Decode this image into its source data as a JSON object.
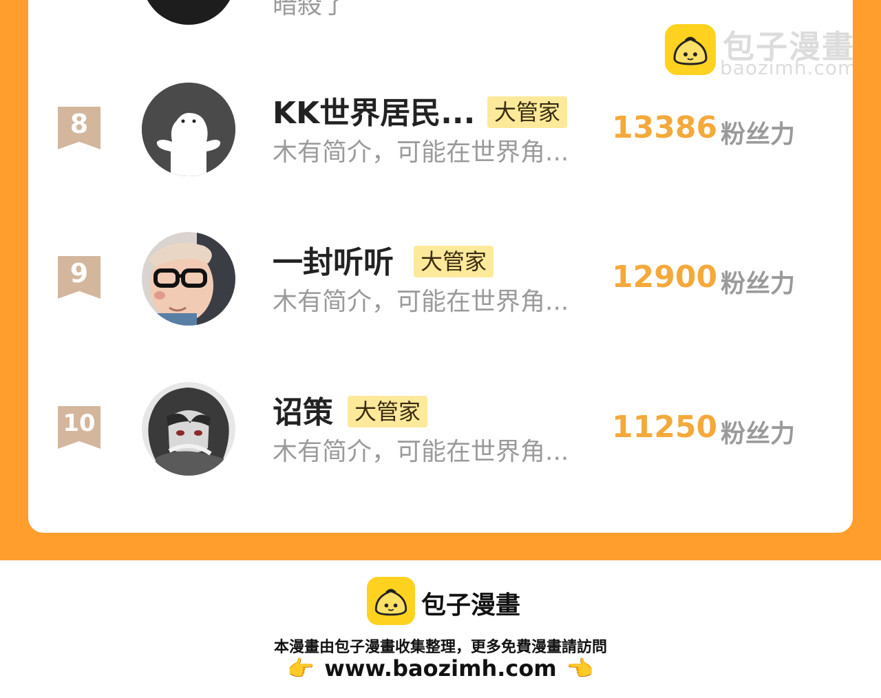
{
  "watermark": {
    "title": "包子漫畫",
    "subtitle": "baozimh.com"
  },
  "partial_row": {
    "text": "暗殺了"
  },
  "rows": [
    {
      "rank": "8",
      "name": "KK世界居民...",
      "badge": "大管家",
      "desc": "木有简介，可能在世界角...",
      "score": "13386",
      "unit": "粉丝力",
      "avatar": "default-ghost-avatar"
    },
    {
      "rank": "9",
      "name": "一封听听",
      "badge": "大管家",
      "desc": "木有简介，可能在世界角...",
      "score": "12900",
      "unit": "粉丝力",
      "avatar": "child-with-glasses-avatar"
    },
    {
      "rank": "10",
      "name": "诏策",
      "badge": "大管家",
      "desc": "木有简介，可能在世界角...",
      "score": "11250",
      "unit": "粉丝力",
      "avatar": "anime-character-avatar"
    }
  ],
  "footer": {
    "title": "包子漫畫",
    "note": "本漫畫由包子漫畫收集整理，更多免費漫畫請訪問",
    "url": "www.baozimh.com",
    "hand_left": "👉",
    "hand_right": "👈"
  },
  "colors": {
    "frame": "#FF9E2C",
    "score": "#F4A93B",
    "badge_bg": "#FCE99A",
    "rank_bg": "#D3B69C",
    "logo": "#FFD21F"
  }
}
